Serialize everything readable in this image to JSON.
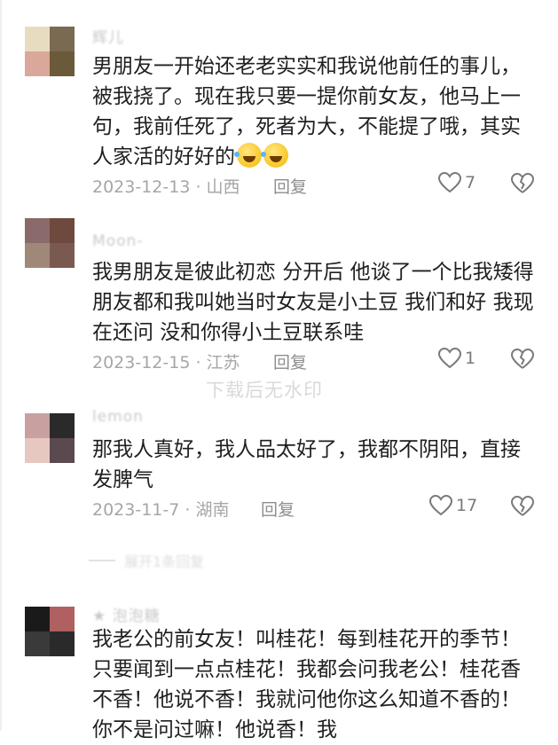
{
  "comments": [
    {
      "username": "辉儿",
      "text": "男朋友一开始还老老实实和我说他前任的事儿，被我挠了。现在我只要一提你前女友，他马上一句，我前任死了，死者为大，不能提了哦，其实人家活的好好的",
      "emoji": "laughing-crying-emoji",
      "date_location": "2023-12-13 · 山西",
      "reply_label": "回复",
      "likes": "7",
      "avatar_colors": [
        "#e8dcc0",
        "#7a6a52",
        "#d9a89a",
        "#6b5a3a"
      ]
    },
    {
      "username": "Moon-",
      "text": "我男朋友是彼此初恋 分开后 他谈了一个比我矮得 朋友都和我叫她当时女友是小土豆 我们和好 我现在还问 没和你得小土豆联系哇",
      "date_location": "2023-12-15 · 江苏",
      "reply_label": "回复",
      "likes": "1",
      "avatar_colors": [
        "#8a6a6a",
        "#6e4a3e",
        "#a08878",
        "#7a5a50"
      ]
    },
    {
      "username": "lemon",
      "text": "那我人真好，我人品太好了，我都不阴阳，直接发脾气",
      "date_location": "2023-11-7 · 湖南",
      "reply_label": "回复",
      "likes": "17",
      "avatar_colors": [
        "#c8a0a0",
        "#2a2a2a",
        "#e6c8c0",
        "#5a4a50"
      ]
    },
    {
      "username": "★ 泡泡糖",
      "text": "我老公的前女友！叫桂花！每到桂花开的季节！只要闻到一点点桂花！我都会问我老公！桂花香不香！他说不香！我就问他你这么知道不香的！你不是问过嘛！他说香！我",
      "avatar_colors": [
        "#1a1a1a",
        "#b06060",
        "#3a3a3a",
        "#2a2a2a"
      ]
    }
  ],
  "collapsed_replies": "展开1条回复",
  "watermark": "下载后无水印",
  "colors": {
    "text": "#1f1f1f",
    "meta": "#a6a6a6",
    "username": "#c9c9c9",
    "icon": "#7a7a7a"
  }
}
